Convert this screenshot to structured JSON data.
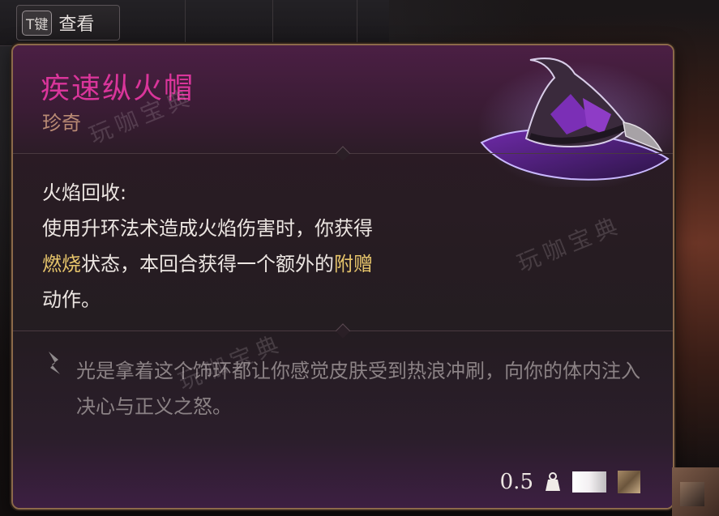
{
  "hint": {
    "key": "T键",
    "label": "查看"
  },
  "item": {
    "name": "疾速纵火帽",
    "rarity": "珍奇",
    "name_color": "#d9359a",
    "rarity_color": "#b98a74",
    "image_icon": "wizard-hat-icon"
  },
  "ability": {
    "title": "火焰回收:",
    "line1": "使用升环法术造成火焰伤害时，你获得",
    "kw1": "燃烧",
    "line2_mid": "状态，本回合获得一个额外的",
    "kw2": "附赠",
    "line3": "动作。",
    "keyword_color": "#e6c46b"
  },
  "flavor": {
    "icon": "quote-feather-icon",
    "text": "光是拿着这个饰环都让你感觉皮肤受到热浪冲刷，向你的体内注入决心与正义之怒。"
  },
  "footer": {
    "weight": "0.5",
    "weight_icon": "weight-icon"
  },
  "watermark": "玩咖宝典"
}
